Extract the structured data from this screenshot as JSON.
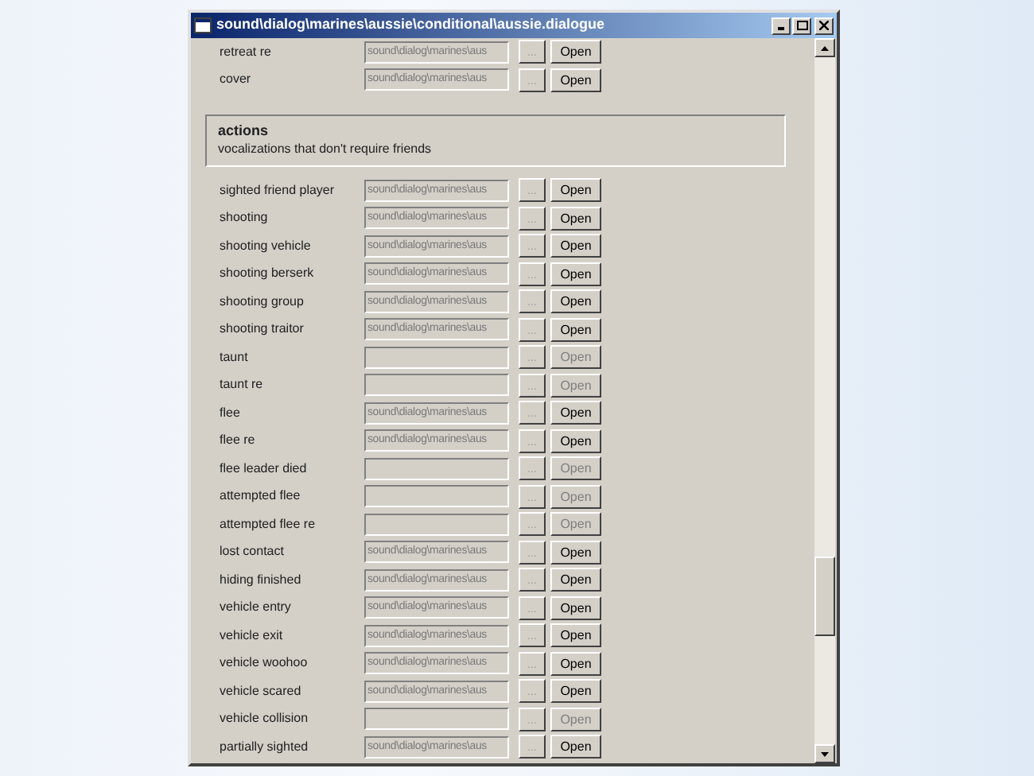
{
  "window": {
    "title": "sound\\dialog\\marines\\aussie\\conditional\\aussie.dialogue"
  },
  "top_rows": [
    {
      "label": "retreat re",
      "value": "sound\\dialog\\marines\\aus",
      "browse": "...",
      "open": "Open",
      "enabled": true
    },
    {
      "label": "cover",
      "value": "sound\\dialog\\marines\\aus",
      "browse": "...",
      "open": "Open",
      "enabled": true
    }
  ],
  "group": {
    "title": "actions",
    "description": "vocalizations that don't require friends"
  },
  "rows": [
    {
      "label": "sighted friend player",
      "value": "sound\\dialog\\marines\\aus",
      "browse": "...",
      "open": "Open",
      "enabled": true
    },
    {
      "label": "shooting",
      "value": "sound\\dialog\\marines\\aus",
      "browse": "...",
      "open": "Open",
      "enabled": true
    },
    {
      "label": "shooting vehicle",
      "value": "sound\\dialog\\marines\\aus",
      "browse": "...",
      "open": "Open",
      "enabled": true
    },
    {
      "label": "shooting berserk",
      "value": "sound\\dialog\\marines\\aus",
      "browse": "...",
      "open": "Open",
      "enabled": true
    },
    {
      "label": "shooting group",
      "value": "sound\\dialog\\marines\\aus",
      "browse": "...",
      "open": "Open",
      "enabled": true
    },
    {
      "label": "shooting traitor",
      "value": "sound\\dialog\\marines\\aus",
      "browse": "...",
      "open": "Open",
      "enabled": true
    },
    {
      "label": "taunt",
      "browse": "...",
      "open": "Open",
      "enabled": false
    },
    {
      "label": "taunt re",
      "browse": "...",
      "open": "Open",
      "enabled": false
    },
    {
      "label": "flee",
      "value": "sound\\dialog\\marines\\aus",
      "browse": "...",
      "open": "Open",
      "enabled": true
    },
    {
      "label": "flee re",
      "value": "sound\\dialog\\marines\\aus",
      "browse": "...",
      "open": "Open",
      "enabled": true
    },
    {
      "label": "flee leader died",
      "browse": "...",
      "open": "Open",
      "enabled": false
    },
    {
      "label": "attempted flee",
      "browse": "...",
      "open": "Open",
      "enabled": false
    },
    {
      "label": "attempted flee re",
      "browse": "...",
      "open": "Open",
      "enabled": false
    },
    {
      "label": "lost contact",
      "value": "sound\\dialog\\marines\\aus",
      "browse": "...",
      "open": "Open",
      "enabled": true
    },
    {
      "label": "hiding finished",
      "value": "sound\\dialog\\marines\\aus",
      "browse": "...",
      "open": "Open",
      "enabled": true
    },
    {
      "label": "vehicle entry",
      "value": "sound\\dialog\\marines\\aus",
      "browse": "...",
      "open": "Open",
      "enabled": true
    },
    {
      "label": "vehicle exit",
      "value": "sound\\dialog\\marines\\aus",
      "browse": "...",
      "open": "Open",
      "enabled": true
    },
    {
      "label": "vehicle woohoo",
      "value": "sound\\dialog\\marines\\aus",
      "browse": "...",
      "open": "Open",
      "enabled": true
    },
    {
      "label": "vehicle scared",
      "value": "sound\\dialog\\marines\\aus",
      "browse": "...",
      "open": "Open",
      "enabled": true
    },
    {
      "label": "vehicle collision",
      "browse": "...",
      "open": "Open",
      "enabled": false
    },
    {
      "label": "partially sighted",
      "value": "sound\\dialog\\marines\\aus",
      "browse": "...",
      "open": "Open",
      "enabled": true
    }
  ]
}
